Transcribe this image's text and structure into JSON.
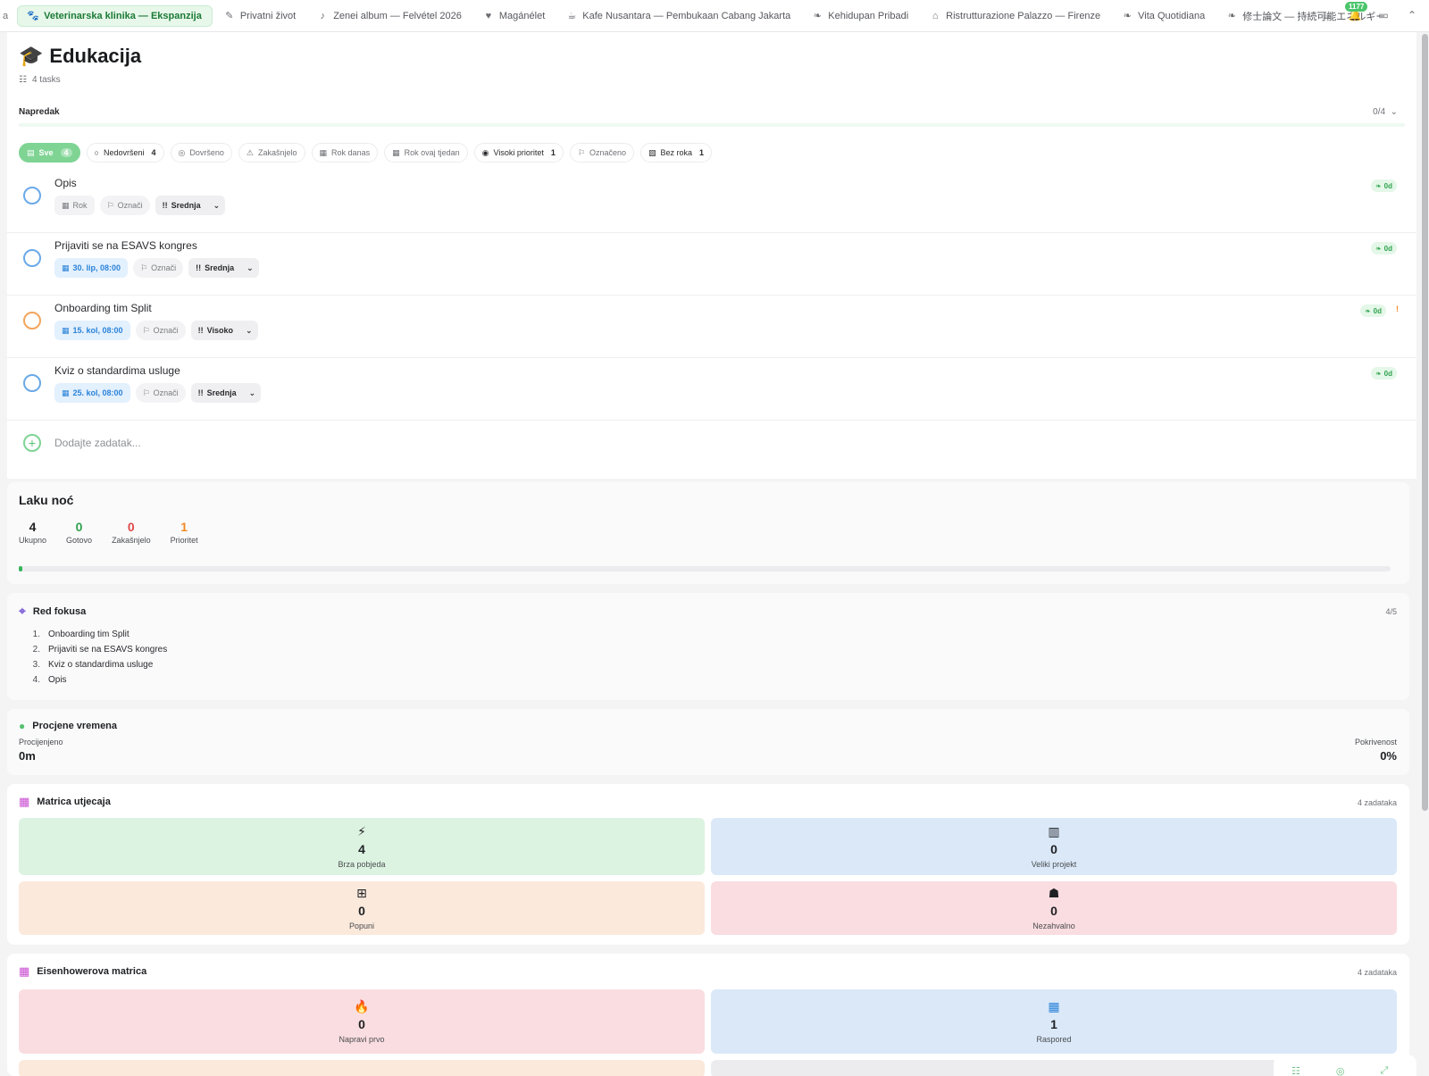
{
  "tabs": {
    "stub": "a",
    "items": [
      {
        "label": "Veterinarska klinika — Ekspanzija",
        "icon": "paw-icon",
        "active": true
      },
      {
        "label": "Privatni život",
        "icon": "edit-icon"
      },
      {
        "label": "Zenei album — Felvétel 2026",
        "icon": "music-note-icon"
      },
      {
        "label": "Magánélet",
        "icon": "heart-icon"
      },
      {
        "label": "Kafe Nusantara — Pembukaan Cabang Jakarta",
        "icon": "hat-icon"
      },
      {
        "label": "Kehidupan Pribadi",
        "icon": "leaf-icon"
      },
      {
        "label": "Ristrutturazione Palazzo — Firenze",
        "icon": "building-icon"
      },
      {
        "label": "Vita Quotidiana",
        "icon": "leaf-icon"
      },
      {
        "label": "修士論文 — 持続可能エネルギー",
        "icon": "leaf-icon"
      }
    ],
    "notif_count": "1177"
  },
  "header": {
    "title": "Edukacija",
    "task_count": "4 tasks"
  },
  "progress": {
    "label": "Napredak",
    "count": "0/4"
  },
  "filters": [
    {
      "label": "Sve",
      "count": "4",
      "active": true,
      "icon": "stack-icon"
    },
    {
      "label": "Nedovršeni",
      "count": "4",
      "icon": "circle-icon",
      "dark": true
    },
    {
      "label": "Dovršeno",
      "icon": "check-circle-icon"
    },
    {
      "label": "Zakašnjelo",
      "icon": "warning-icon"
    },
    {
      "label": "Rok danas",
      "icon": "calendar-icon"
    },
    {
      "label": "Rok ovaj tjedan",
      "icon": "calendar-icon"
    },
    {
      "label": "Visoki prioritet",
      "count": "1",
      "icon": "target-icon",
      "dark": true
    },
    {
      "label": "Označeno",
      "icon": "flag-icon"
    },
    {
      "label": "Bez roka",
      "count": "1",
      "icon": "calendar-x-icon",
      "dark": true
    }
  ],
  "tasks": [
    {
      "name": "Opis",
      "date": "Rok",
      "has_date": false,
      "flag": "Označi",
      "priority": "Srednja",
      "time": "0d",
      "circle": "blue"
    },
    {
      "name": "Prijaviti se na ESAVS kongres",
      "date": "30. lip, 08:00",
      "has_date": true,
      "flag": "Označi",
      "priority": "Srednja",
      "time": "0d",
      "circle": "blue"
    },
    {
      "name": "Onboarding tim Split",
      "date": "15. kol, 08:00",
      "has_date": true,
      "flag": "Označi",
      "priority": "Visoko",
      "time": "0d",
      "circle": "orange",
      "mark": "!"
    },
    {
      "name": "Kviz o standardima usluge",
      "date": "25. kol, 08:00",
      "has_date": true,
      "flag": "Označi",
      "priority": "Srednja",
      "time": "0d",
      "circle": "blue"
    }
  ],
  "add_task": {
    "placeholder": "Dodajte zadatak..."
  },
  "night": {
    "title": "Laku noć",
    "stats": [
      {
        "value": "4",
        "label": "Ukupno",
        "color": "#1f2023"
      },
      {
        "value": "0",
        "label": "Gotovo",
        "color": "#2fa24e"
      },
      {
        "value": "0",
        "label": "Zakašnjelo",
        "color": "#e04848"
      },
      {
        "value": "1",
        "label": "Prioritet",
        "color": "#f08a24"
      }
    ],
    "progress_fraction": 0.0
  },
  "focus": {
    "title": "Red fokusa",
    "count": "4/5",
    "items": [
      "Onboarding tim Split",
      "Prijaviti se na ESAVS kongres",
      "Kviz o standardima usluge",
      "Opis"
    ]
  },
  "estimates": {
    "title": "Procjene vremena",
    "estimated_label": "Procijenjeno",
    "estimated_value": "0m",
    "coverage_label": "Pokrivenost",
    "coverage_value": "0%"
  },
  "impact": {
    "title": "Matrica utjecaja",
    "count": "4 zadataka",
    "cells": [
      {
        "value": "4",
        "label": "Brza pobjeda",
        "icon": "bolt-icon",
        "tone": "green"
      },
      {
        "value": "0",
        "label": "Veliki projekt",
        "icon": "building-icon",
        "tone": "blue"
      },
      {
        "value": "0",
        "label": "Popuni",
        "icon": "grid-icon",
        "tone": "peach"
      },
      {
        "value": "0",
        "label": "Nezahvalno",
        "icon": "turtle-icon",
        "tone": "pink"
      }
    ]
  },
  "eisenhower": {
    "title": "Eisenhowerova matrica",
    "count": "4 zadataka",
    "cells": [
      {
        "value": "0",
        "label": "Napravi prvo",
        "icon": "fire-icon",
        "tone": "pink"
      },
      {
        "value": "1",
        "label": "Raspored",
        "icon": "calendar-icon",
        "tone": "blue"
      }
    ]
  },
  "colors": {
    "accent": "#35b55a",
    "blue": "#2b83d9",
    "orange": "#f08a24",
    "red": "#e04848"
  }
}
